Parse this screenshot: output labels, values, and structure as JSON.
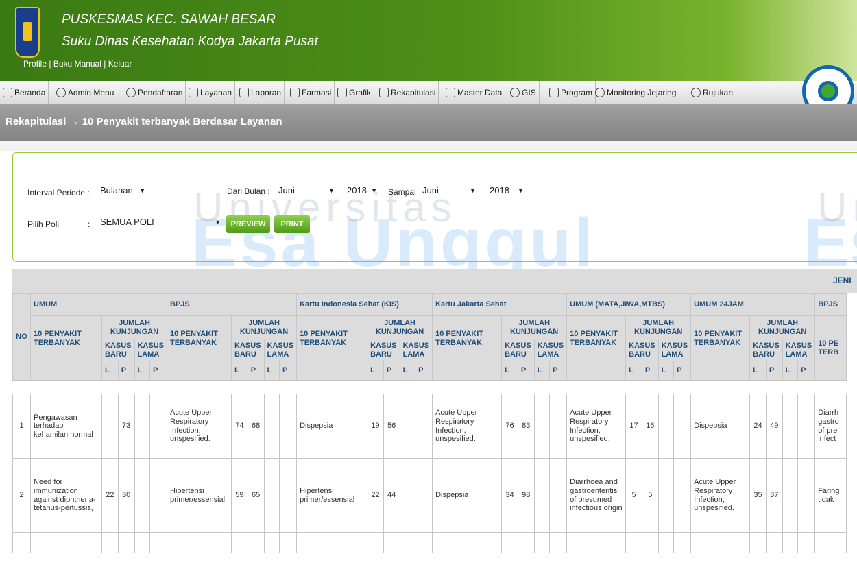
{
  "header": {
    "title": "PUSKESMAS KEC. SAWAH BESAR",
    "subtitle": "Suku Dinas Kesehatan Kodya Jakarta Pusat",
    "links": [
      "Profile",
      "|",
      "Buku Manual",
      "|",
      "Keluar"
    ]
  },
  "nav": [
    "Beranda",
    "Admin Menu",
    "Pendaftaran",
    "Layanan",
    "Laporan",
    "Farmasi",
    "Grafik",
    "Rekapitulasi",
    "Master Data",
    "GIS",
    "Program",
    "Monitoring Jejaring",
    "Rujukan"
  ],
  "page_title": "Rekapitulasi → 10 Penyakit terbanyak Berdasar Layanan",
  "filter": {
    "interval_label": "Interval Periode :",
    "interval": "Bulanan",
    "dari_label": "Dari Bulan :",
    "dari_bulan": "Juni",
    "dari_tahun": "2018",
    "sampai_label": "Sampai",
    "sampai_bulan": "Juni",
    "sampai_tahun": "2018",
    "poli_label": "Pilih Poli",
    "poli_colon": ":",
    "poli": "SEMUA POLI",
    "preview": "PREVIEW",
    "print": "PRINT"
  },
  "watermark": {
    "line1": "Universitas",
    "line2": "Esa Unggul",
    "line3": "Uni",
    "line4": "Es"
  },
  "table": {
    "jenis": "JENI",
    "no": "NO",
    "groups": [
      "UMUM",
      "BPJS",
      "Kartu Indonesia Sehat (KIS)",
      "Kartu Jakarta Sehat",
      "UMUM (MATA,JIWA,MTBS)",
      "UMUM 24JAM",
      "BPJS"
    ],
    "col_penyakit": "10 PENYAKIT TERBANYAK",
    "col_penyakit_cut": "10 PE TERB",
    "jumlah": "JUMLAH KUNJUNGAN",
    "baru": "KASUS BARU",
    "lama": "KASUS LAMA",
    "L": "L",
    "P": "P",
    "rows": [
      {
        "no": "1",
        "cells": [
          [
            "Pengawasan terhadap kehamilan normal",
            "",
            "73"
          ],
          [
            "Acute Upper Respiratory Infection, unspesified.",
            "74",
            "68"
          ],
          [
            "Dispepsia",
            "19",
            "56"
          ],
          [
            "Acute Upper Respiratory Infection, unspesified.",
            "76",
            "83"
          ],
          [
            "Acute Upper Respiratory Infection, unspesified.",
            "17",
            "16"
          ],
          [
            "Dispepsia",
            "24",
            "49"
          ]
        ],
        "last": "Diarrh gastro of pre infect"
      },
      {
        "no": "2",
        "cells": [
          [
            "Need for immunization against diphtheria-tetanus-pertussis,",
            "22",
            "30"
          ],
          [
            "Hipertensi primer/essensial",
            "59",
            "65"
          ],
          [
            "Hipertensi primer/essensial",
            "22",
            "44"
          ],
          [
            "Dispepsia",
            "34",
            "98"
          ],
          [
            "Diarrhoea and gastroenteritis of presumed infectious origin",
            "5",
            "5"
          ],
          [
            "Acute Upper Respiratory Infection, unspesified.",
            "35",
            "37"
          ]
        ],
        "last": "Faring tidak"
      }
    ]
  }
}
